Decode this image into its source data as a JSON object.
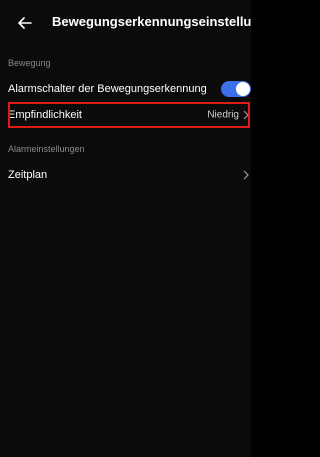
{
  "header": {
    "title": "Bewegungserkennungseinstellun",
    "back_icon": "arrow-left-icon"
  },
  "sections": {
    "motion": {
      "label": "Bewegung",
      "alarm_switch": {
        "label": "Alarmschalter der Bewegungserkennung",
        "enabled": true
      },
      "sensitivity": {
        "label": "Empfindlichkeit",
        "value": "Niedrig"
      }
    },
    "alarm": {
      "label": "Alarmeinstellungen",
      "schedule": {
        "label": "Zeitplan"
      }
    }
  },
  "colors": {
    "background": "#0b0b0b",
    "toggle_on": "#3d6fe8",
    "highlight": "#e01919",
    "section_label": "#8a8a8a"
  }
}
